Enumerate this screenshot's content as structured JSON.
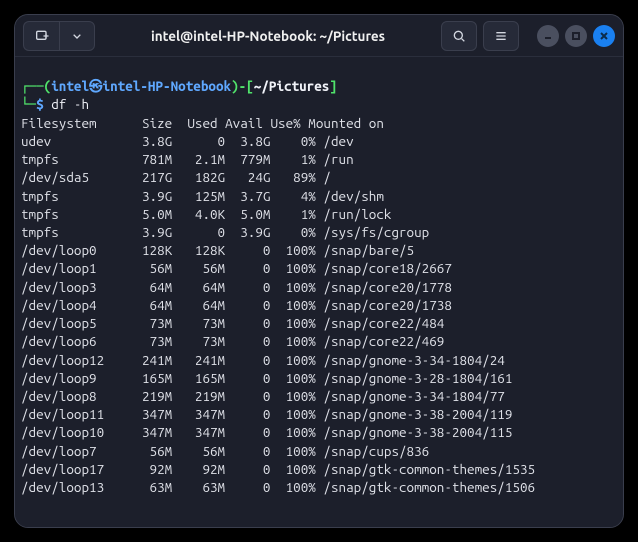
{
  "window": {
    "title": "intel@intel-HP-Notebook: ~/Pictures"
  },
  "prompt": {
    "userhost": "intel㉿intel-HP-Notebook",
    "path": "~/Pictures",
    "command": "df -h"
  },
  "table": {
    "headers": {
      "fs": "Filesystem",
      "size": "Size",
      "used": "Used",
      "avail": "Avail",
      "usep": "Use%",
      "mount": "Mounted on"
    },
    "rows": [
      {
        "fs": "udev",
        "size": "3.8G",
        "used": "0",
        "avail": "3.8G",
        "usep": "0%",
        "mount": "/dev"
      },
      {
        "fs": "tmpfs",
        "size": "781M",
        "used": "2.1M",
        "avail": "779M",
        "usep": "1%",
        "mount": "/run"
      },
      {
        "fs": "/dev/sda5",
        "size": "217G",
        "used": "182G",
        "avail": "24G",
        "usep": "89%",
        "mount": "/"
      },
      {
        "fs": "tmpfs",
        "size": "3.9G",
        "used": "125M",
        "avail": "3.7G",
        "usep": "4%",
        "mount": "/dev/shm"
      },
      {
        "fs": "tmpfs",
        "size": "5.0M",
        "used": "4.0K",
        "avail": "5.0M",
        "usep": "1%",
        "mount": "/run/lock"
      },
      {
        "fs": "tmpfs",
        "size": "3.9G",
        "used": "0",
        "avail": "3.9G",
        "usep": "0%",
        "mount": "/sys/fs/cgroup"
      },
      {
        "fs": "/dev/loop0",
        "size": "128K",
        "used": "128K",
        "avail": "0",
        "usep": "100%",
        "mount": "/snap/bare/5"
      },
      {
        "fs": "/dev/loop1",
        "size": "56M",
        "used": "56M",
        "avail": "0",
        "usep": "100%",
        "mount": "/snap/core18/2667"
      },
      {
        "fs": "/dev/loop3",
        "size": "64M",
        "used": "64M",
        "avail": "0",
        "usep": "100%",
        "mount": "/snap/core20/1778"
      },
      {
        "fs": "/dev/loop4",
        "size": "64M",
        "used": "64M",
        "avail": "0",
        "usep": "100%",
        "mount": "/snap/core20/1738"
      },
      {
        "fs": "/dev/loop5",
        "size": "73M",
        "used": "73M",
        "avail": "0",
        "usep": "100%",
        "mount": "/snap/core22/484"
      },
      {
        "fs": "/dev/loop6",
        "size": "73M",
        "used": "73M",
        "avail": "0",
        "usep": "100%",
        "mount": "/snap/core22/469"
      },
      {
        "fs": "/dev/loop12",
        "size": "241M",
        "used": "241M",
        "avail": "0",
        "usep": "100%",
        "mount": "/snap/gnome-3-34-1804/24"
      },
      {
        "fs": "/dev/loop9",
        "size": "165M",
        "used": "165M",
        "avail": "0",
        "usep": "100%",
        "mount": "/snap/gnome-3-28-1804/161"
      },
      {
        "fs": "/dev/loop8",
        "size": "219M",
        "used": "219M",
        "avail": "0",
        "usep": "100%",
        "mount": "/snap/gnome-3-34-1804/77"
      },
      {
        "fs": "/dev/loop11",
        "size": "347M",
        "used": "347M",
        "avail": "0",
        "usep": "100%",
        "mount": "/snap/gnome-3-38-2004/119"
      },
      {
        "fs": "/dev/loop10",
        "size": "347M",
        "used": "347M",
        "avail": "0",
        "usep": "100%",
        "mount": "/snap/gnome-3-38-2004/115"
      },
      {
        "fs": "/dev/loop7",
        "size": "56M",
        "used": "56M",
        "avail": "0",
        "usep": "100%",
        "mount": "/snap/cups/836"
      },
      {
        "fs": "/dev/loop17",
        "size": "92M",
        "used": "92M",
        "avail": "0",
        "usep": "100%",
        "mount": "/snap/gtk-common-themes/1535"
      },
      {
        "fs": "/dev/loop13",
        "size": "63M",
        "used": "63M",
        "avail": "0",
        "usep": "100%",
        "mount": "/snap/gtk-common-themes/1506"
      }
    ]
  }
}
